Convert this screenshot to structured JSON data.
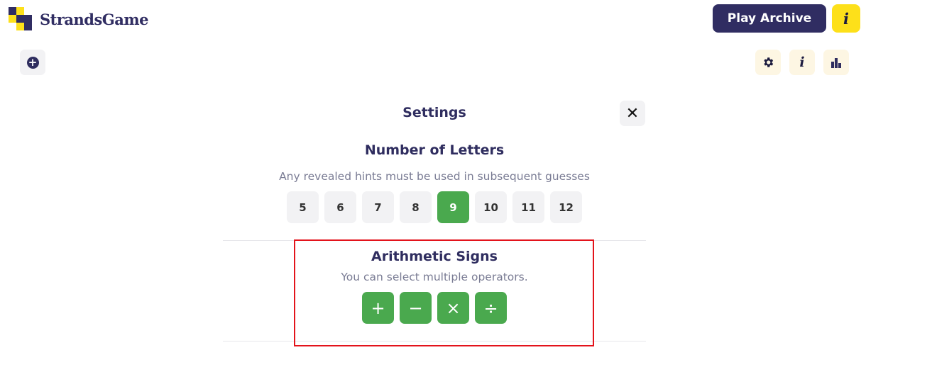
{
  "header": {
    "brand": "StrandsGame",
    "play_archive_label": "Play Archive",
    "info_label": "i"
  },
  "toolbar": {
    "add_icon": "plus-circle-icon",
    "settings_icon": "gear-icon",
    "info_label": "i",
    "stats_icon": "bar-chart-icon"
  },
  "modal": {
    "title": "Settings",
    "close_label": "✕",
    "letters": {
      "title": "Number of Letters",
      "subtitle": "Any revealed hints must be used in subsequent guesses",
      "options": [
        "5",
        "6",
        "7",
        "8",
        "9",
        "10",
        "11",
        "12"
      ],
      "selected": "9"
    },
    "signs": {
      "title": "Arithmetic Signs",
      "subtitle": "You can select multiple operators.",
      "options": [
        "+",
        "−",
        "×",
        "÷"
      ]
    }
  },
  "colors": {
    "brand_navy": "#302d62",
    "accent_yellow": "#fde01a",
    "active_green": "#4aa94e",
    "highlight_red": "#e3131b"
  }
}
